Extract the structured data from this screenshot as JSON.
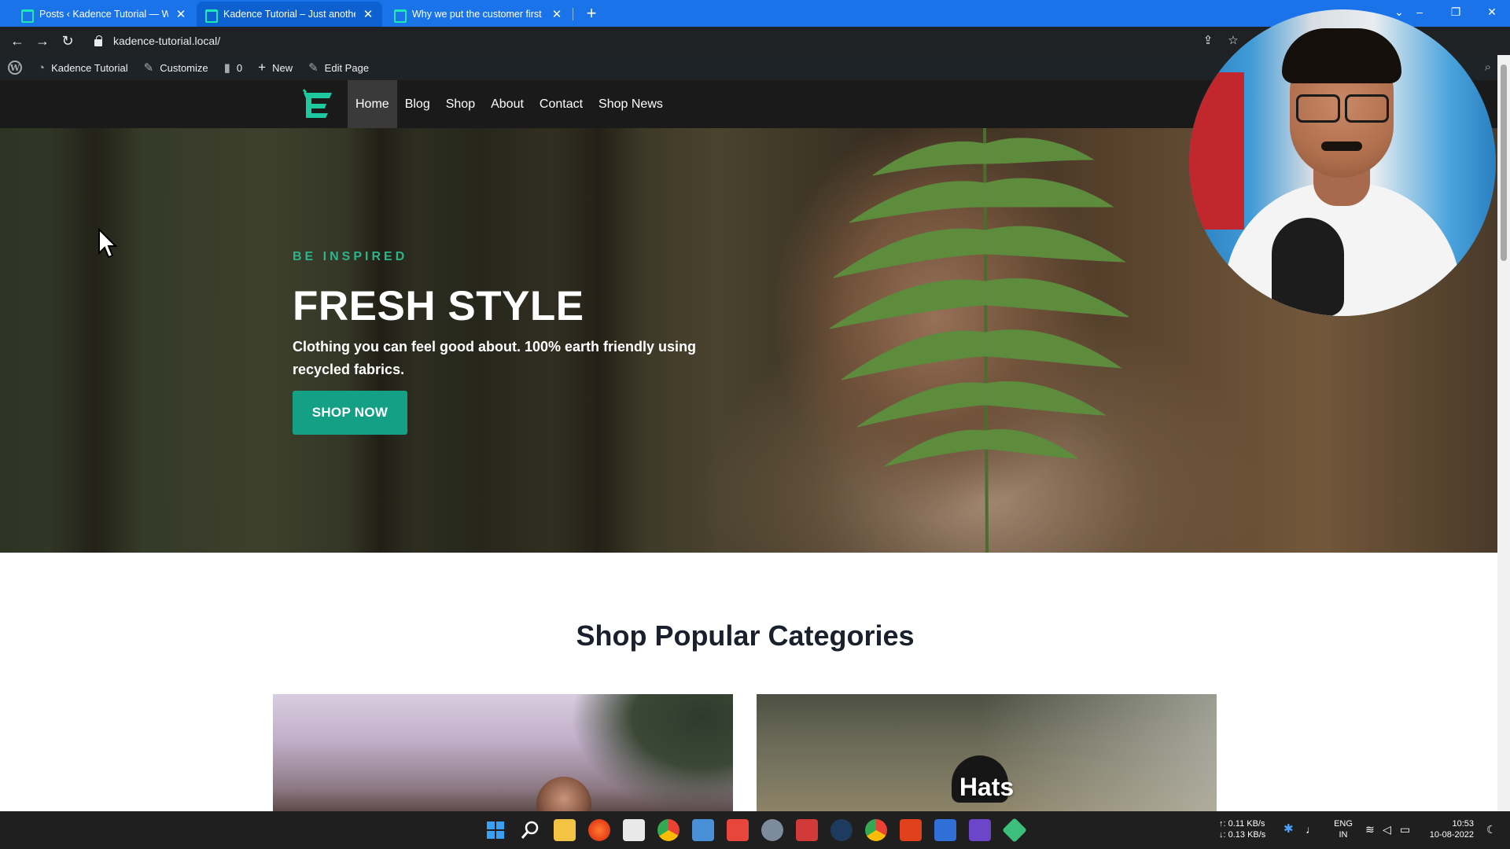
{
  "browser": {
    "tabs": [
      {
        "title": "Posts ‹ Kadence Tutorial — WordPress",
        "close": "✕"
      },
      {
        "title": "Kadence Tutorial – Just another WordPress site",
        "close": "✕"
      },
      {
        "title": "Why we put the customer first – Kadence Tutorial",
        "close": "✕"
      }
    ],
    "new_tab": "+",
    "url": "kadence-tutorial.local/"
  },
  "wp_admin_bar": {
    "site_name": "Kadence Tutorial",
    "customize": "Customize",
    "comments_count": "0",
    "new": "New",
    "edit_page": "Edit Page"
  },
  "site": {
    "nav": [
      "Home",
      "Blog",
      "Shop",
      "About",
      "Contact",
      "Shop News"
    ],
    "accent": "#14a085"
  },
  "hero": {
    "kicker": "BE INSPIRED",
    "headline": "FRESH STYLE",
    "subline": "Clothing you can feel good about. 100% earth friendly using recycled fabrics.",
    "button": "SHOP NOW"
  },
  "categories": {
    "title": "Shop Popular Categories",
    "items": [
      {
        "label": ""
      },
      {
        "label": "Hats"
      }
    ]
  },
  "taskbar": {
    "net_up": "↑: 0.11 KB/s",
    "net_down": "↓: 0.13 KB/s",
    "lang": "ENG",
    "region": "IN",
    "time": "10:53",
    "date": "10-08-2022"
  }
}
